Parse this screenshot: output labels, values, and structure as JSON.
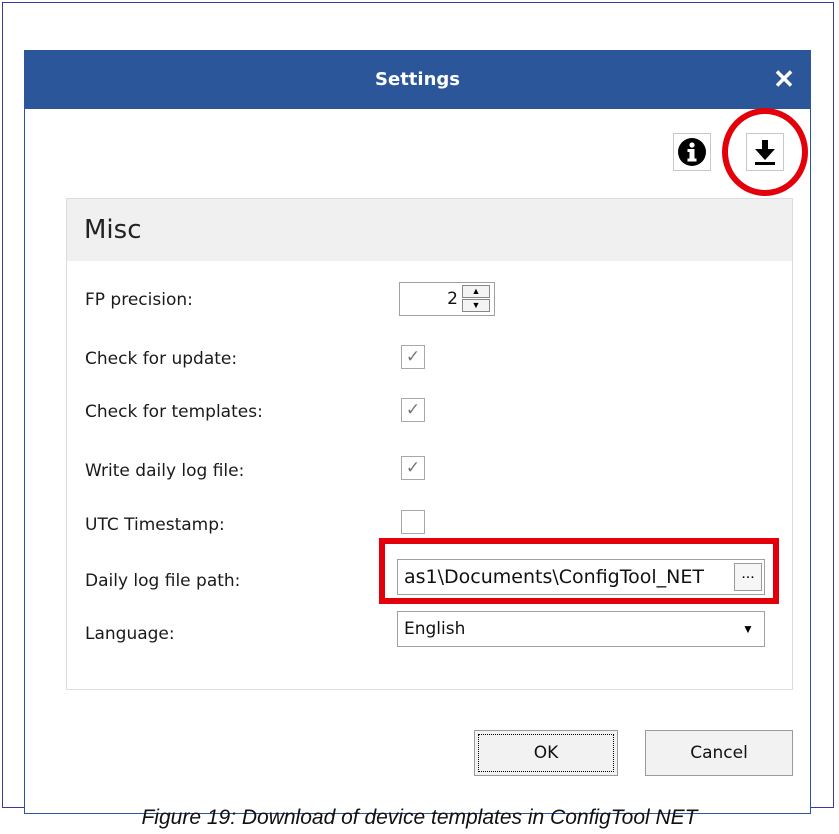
{
  "dialog": {
    "title": "Settings",
    "close_icon": "close-icon",
    "info_icon": "info-icon",
    "download_icon": "download-icon"
  },
  "panel": {
    "title": "Misc",
    "rows": {
      "fp_precision": {
        "label": "FP precision:",
        "value": "2"
      },
      "check_update": {
        "label": "Check for update:",
        "checked": true
      },
      "check_templates": {
        "label": "Check for templates:",
        "checked": true
      },
      "write_log": {
        "label": "Write daily log file:",
        "checked": true
      },
      "utc": {
        "label": "UTC Timestamp:",
        "checked": false
      },
      "log_path": {
        "label": "Daily log file path:",
        "value": "as1\\Documents\\ConfigTool_NET",
        "browse_label": "..."
      },
      "language": {
        "label": "Language:",
        "value": "English"
      }
    }
  },
  "buttons": {
    "ok": "OK",
    "cancel": "Cancel"
  },
  "caption": "Figure 19: Download of device templates in ConfigTool NET",
  "colors": {
    "titlebar": "#2b579a",
    "annotation": "#e3000b"
  }
}
